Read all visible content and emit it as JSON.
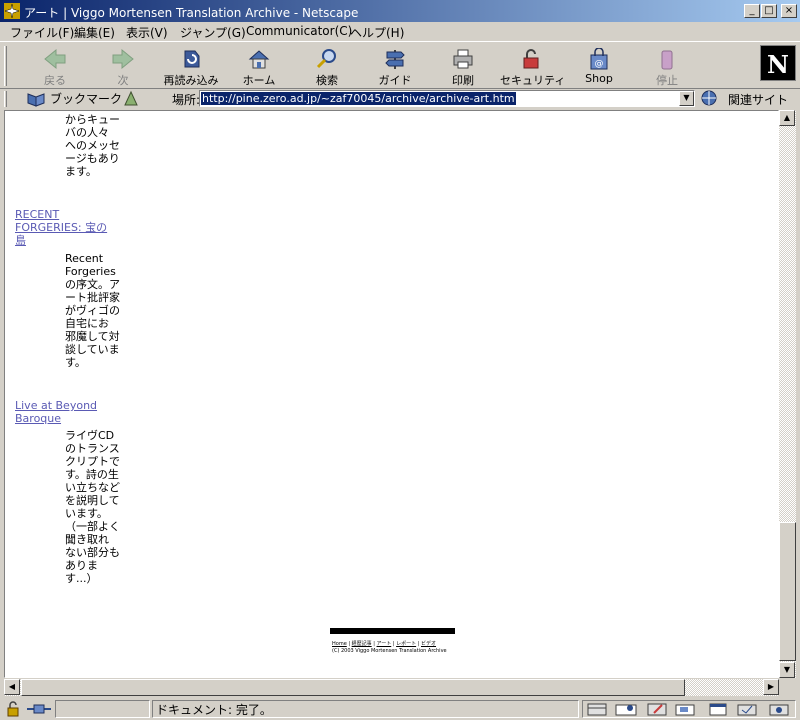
{
  "window": {
    "title": "アート | Viggo Mortensen Translation Archive - Netscape",
    "minimize_icon": "minimize-icon",
    "maximize_icon": "maximize-icon",
    "close_icon": "close-icon"
  },
  "menu": [
    "ファイル(F)",
    "編集(E)",
    "表示(V)",
    "ジャンプ(G)",
    "Communicator(C)",
    "ヘルプ(H)"
  ],
  "toolbar": {
    "back": "戻る",
    "forward": "次",
    "reload": "再読み込み",
    "home": "ホーム",
    "search": "検索",
    "guide": "ガイド",
    "print": "印刷",
    "security": "セキュリティ",
    "shop": "Shop",
    "stop": "停止",
    "logo": "N"
  },
  "location": {
    "bookmarks": "ブックマーク",
    "label": "場所:",
    "url": "http://pine.zero.ad.jp/~zaf70045/archive/archive-art.htm",
    "related": "関連サイト"
  },
  "content": {
    "intro_lines": [
      "からキュー",
      "バの人々",
      "へのメッセ",
      "ージもあり",
      "ます。"
    ],
    "item1": {
      "title_lines": [
        "RECENT",
        "FORGERIES: 宝の",
        "島"
      ],
      "desc_lines": [
        "Recent",
        "Forgeries",
        "の序文。ア",
        "ート批評家",
        "がヴィゴの",
        "自宅にお",
        "邪魔して対",
        "談していま",
        "す。"
      ]
    },
    "item2": {
      "title_lines": [
        "Live at Beyond",
        "Baroque"
      ],
      "desc_lines": [
        "ライヴCD",
        "のトランス",
        "クリプトで",
        "す。詩の生",
        "い立ちなど",
        "を説明して",
        "います。",
        "（一部よく",
        "聞き取れ",
        "ない部分も",
        "ありま",
        "す...）"
      ]
    },
    "footer": {
      "nav": [
        "Home",
        "経歴記事",
        "アート",
        "レポート",
        "ビデオ"
      ],
      "copyright": "(C) 2003 Viggo Mortensen Translation Archive"
    }
  },
  "status": {
    "text": "ドキュメント: 完了。"
  }
}
